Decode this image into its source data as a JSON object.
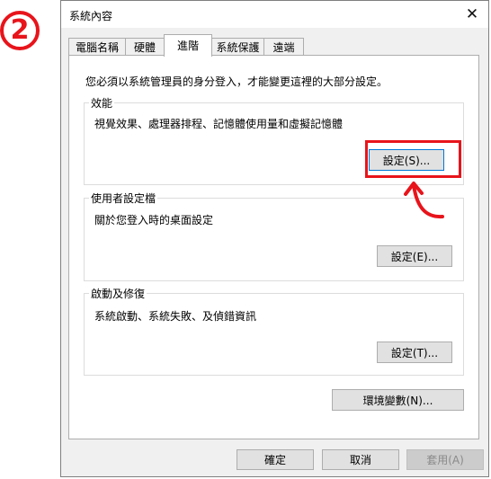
{
  "step_badge": "2",
  "window": {
    "title": "系統內容",
    "close_glyph": "✕"
  },
  "tabs": [
    {
      "label": "電腦名稱"
    },
    {
      "label": "硬體"
    },
    {
      "label": "進階",
      "active": true
    },
    {
      "label": "系統保護"
    },
    {
      "label": "遠端"
    }
  ],
  "notice": "您必須以系統管理員的身分登入，才能變更這裡的大部分設定。",
  "performance": {
    "title": "效能",
    "description": "視覺效果、處理器排程、記憶體使用量和虛擬記憶體",
    "button": "設定(S)..."
  },
  "user_profiles": {
    "title": "使用者設定檔",
    "description": "關於您登入時的桌面設定",
    "button": "設定(E)..."
  },
  "startup_recovery": {
    "title": "啟動及修復",
    "description": "系統啟動、系統失敗、及偵錯資訊",
    "button": "設定(T)..."
  },
  "env_button": "環境變數(N)...",
  "footer": {
    "ok": "確定",
    "cancel": "取消",
    "apply": "套用(A)"
  },
  "colors": {
    "highlight": "#e8141b",
    "focus_border": "#0078d7"
  }
}
